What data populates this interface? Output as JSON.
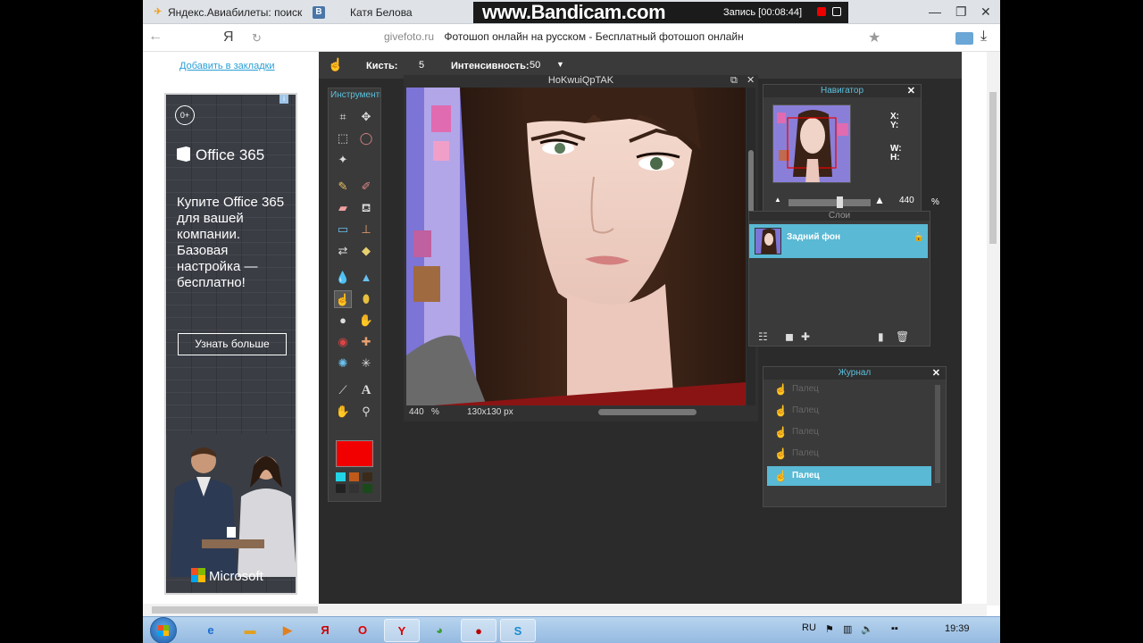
{
  "tabs": [
    {
      "label": "Яндекс.Авиабилеты: поиск и",
      "icon_color": "#f0a020",
      "icon_glyph": "✈"
    },
    {
      "label": "Катя Белова",
      "icon_color": "#4a76a8",
      "icon_glyph": "В"
    }
  ],
  "bandicam": {
    "logo": "www.Bandicam.com",
    "record": "Запись [00:08:44]"
  },
  "address": {
    "brand": "Я",
    "host": "givefoto.ru",
    "title": "Фотошоп онлайн на русском - Бесплатный фотошоп онлайн"
  },
  "page": {
    "bookmark_link": "Добавить в закладки"
  },
  "ad": {
    "age": "0+",
    "brand": "Office 365",
    "headline": "Купите Office 365 для вашей компании. Базовая настройка — бесплатно!",
    "cta": "Узнать больше",
    "footer": "Microsoft"
  },
  "options_bar": {
    "brush_label": "Кисть:",
    "brush_value": "5",
    "intensity_label": "Интенсивность:",
    "intensity_value": "50"
  },
  "toolbox": {
    "title": "Инструменты",
    "primary_color": "#f20000"
  },
  "canvas": {
    "title": "HoKwuiQpTAK",
    "zoom": "440",
    "zoom_unit": "%",
    "size": "130x130 px"
  },
  "navigator": {
    "title": "Навигатор",
    "x_label": "X:",
    "y_label": "Y:",
    "w_label": "W:",
    "h_label": "H:",
    "zoom": "440",
    "zoom_unit": "%"
  },
  "layers": {
    "title": "Слои",
    "items": [
      {
        "name": "Задний фон"
      }
    ]
  },
  "history": {
    "title": "Журнал",
    "items": [
      {
        "label": "Палец",
        "selected": false
      },
      {
        "label": "Палец",
        "selected": false
      },
      {
        "label": "Палец",
        "selected": false
      },
      {
        "label": "Палец",
        "selected": false
      },
      {
        "label": "Палец",
        "selected": true
      }
    ]
  },
  "taskbar": {
    "lang": "RU",
    "time": "19:39"
  }
}
